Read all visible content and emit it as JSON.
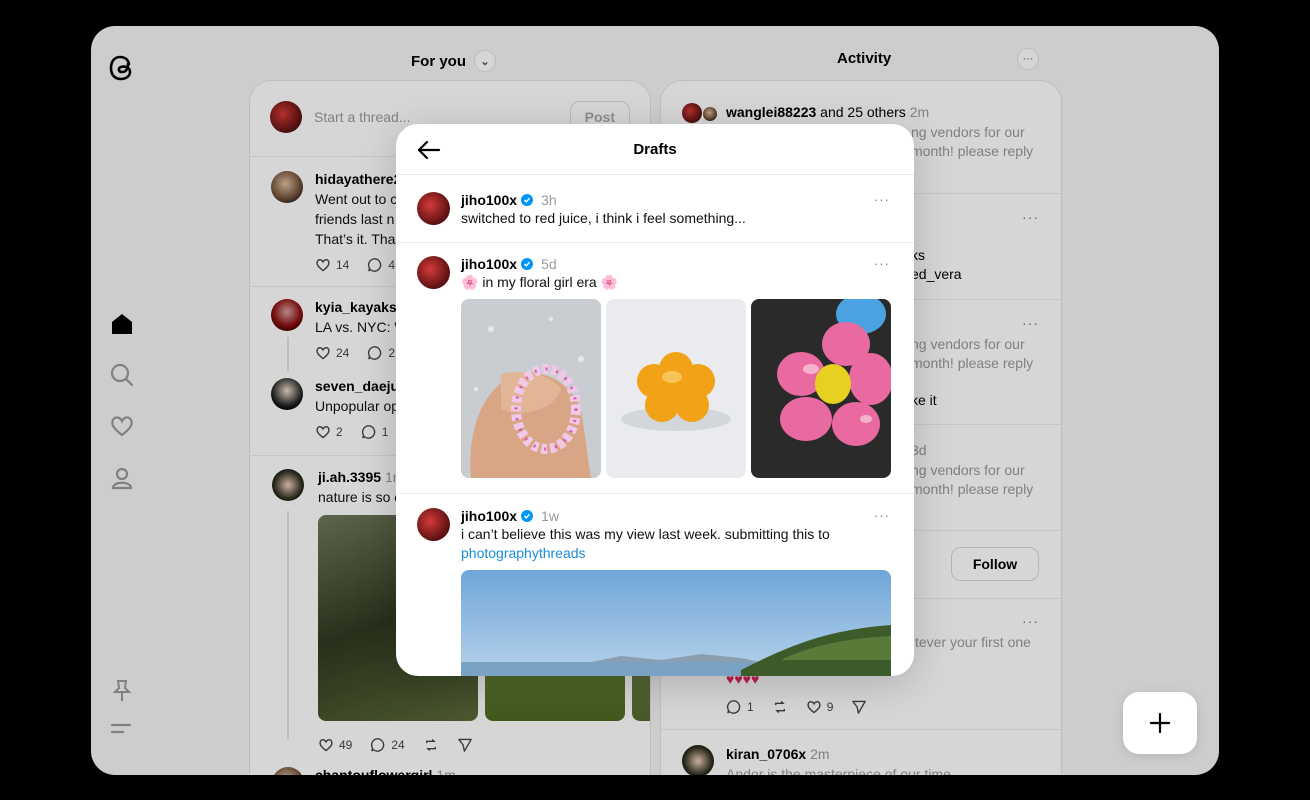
{
  "header": {
    "feed_title": "For you",
    "activity_title": "Activity"
  },
  "compose": {
    "placeholder": "Start a thread...",
    "post_label": "Post"
  },
  "feed": [
    {
      "user": "hidayathere2",
      "lines": [
        "Went out to c",
        "friends last n",
        "That’s it. Tha"
      ],
      "likes": "14",
      "replies": "4"
    },
    {
      "user": "kyia_kayaks",
      "lines": [
        "LA vs. NYC: W"
      ],
      "likes": "24",
      "replies": "2"
    },
    {
      "user": "seven_daejur",
      "lines": [
        "Unpopular op"
      ],
      "likes": "2",
      "replies": "1"
    },
    {
      "user": "ji.ah.3395",
      "time": "1n",
      "lines": [
        "nature is so c"
      ],
      "likes": "49",
      "replies": "24"
    },
    {
      "user": "chantouflowergirl",
      "time": "1m"
    }
  ],
  "activity": [
    {
      "user": "wanglei88223",
      "suffix": " and 25 others",
      "time": "2m",
      "lines": [
        "ng vendors for our",
        "month! please reply"
      ]
    },
    {
      "lines": [
        "ks",
        "ed_vera"
      ]
    },
    {
      "lines": [
        "ng vendors for our",
        "month! please reply",
        "",
        "ke it"
      ]
    },
    {
      "time": "3d",
      "lines": [
        "ng vendors for our",
        "month! please reply"
      ]
    },
    {
      "follow_label": "Follow"
    },
    {
      "lines": [
        "tever your first one"
      ],
      "hearts": "♥♥♥♥",
      "replies": "1",
      "likes": "9"
    },
    {
      "user": "kiran_0706x",
      "time": "2m",
      "lines": [
        "Andor is the masterpiece of our time"
      ]
    }
  ],
  "drafts_modal": {
    "title": "Drafts",
    "items": [
      {
        "user": "jiho100x",
        "time": "3h",
        "text": "switched to red juice, i think i feel something..."
      },
      {
        "user": "jiho100x",
        "time": "5d",
        "text_prefix": "🌸",
        "text": " in my floral girl era ",
        "text_suffix": "🌸"
      },
      {
        "user": "jiho100x",
        "time": "1w",
        "text": "i can’t believe this was my view last week. submitting this to",
        "link": "photographythreads"
      }
    ]
  },
  "colors": {
    "accent": "#0095f6",
    "link": "#1a8cd8"
  }
}
